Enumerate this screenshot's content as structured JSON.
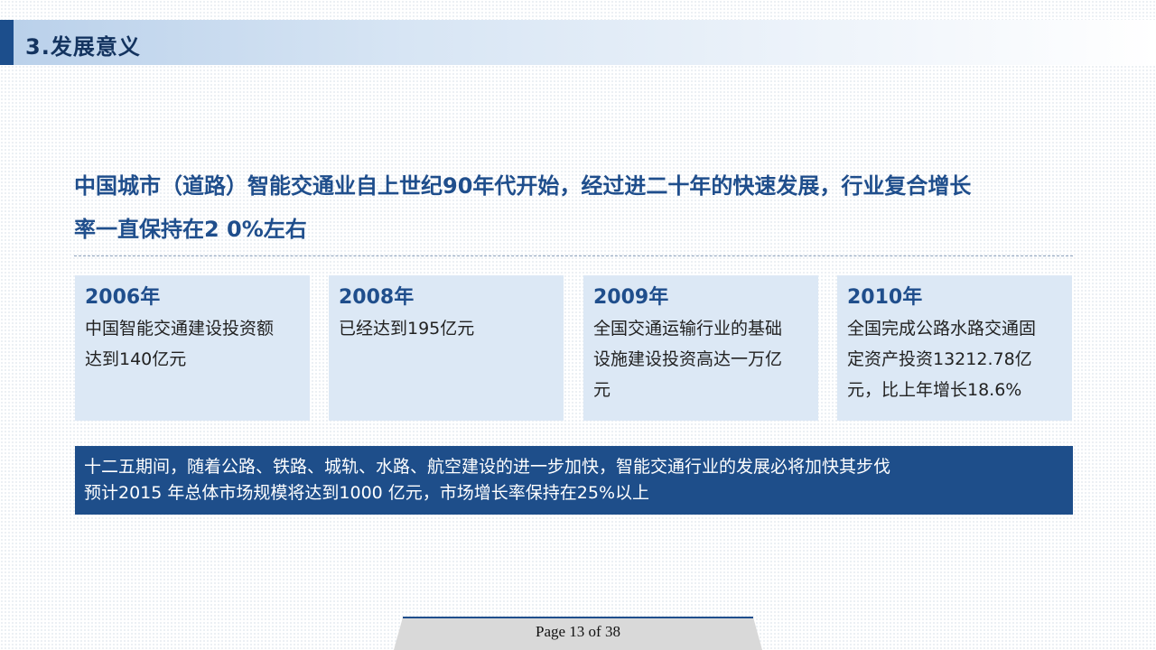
{
  "header": {
    "title": "3.发展意义"
  },
  "headline": {
    "line1": "中国城市（道路）智能交通业自上世纪90年代开始，经过进二十年的快速发展，行业复合增长",
    "line2": "率一直保持在2 0%左右"
  },
  "cards": [
    {
      "year": "2006年",
      "lines": [
        "中国智能交通建设投资额",
        "达到140亿元"
      ]
    },
    {
      "year": "2008年",
      "lines": [
        "已经达到195亿元"
      ]
    },
    {
      "year": "2009年",
      "lines": [
        "全国交通运输行业的基础",
        "设施建设投资高达一万亿",
        "元"
      ]
    },
    {
      "year": "2010年",
      "lines": [
        "全国完成公路水路交通固",
        "定资产投资13212.78亿",
        "元，比上年增长18.6%"
      ]
    }
  ],
  "summary": {
    "line1": "十二五期间，随着公路、铁路、城轨、水路、航空建设的进一步加快，智能交通行业的发展必将加快其步伐",
    "line2": "预计2015 年总体市场规模将达到1000 亿元，市场增长率保持在25%以上"
  },
  "footer": {
    "page_label": "Page 13 of 38"
  },
  "colors": {
    "accent": "#1f4e8c",
    "header_bar": "#1c4e8c",
    "card_bg": "#dce8f5",
    "summary_bg": "#1e4e8a"
  }
}
